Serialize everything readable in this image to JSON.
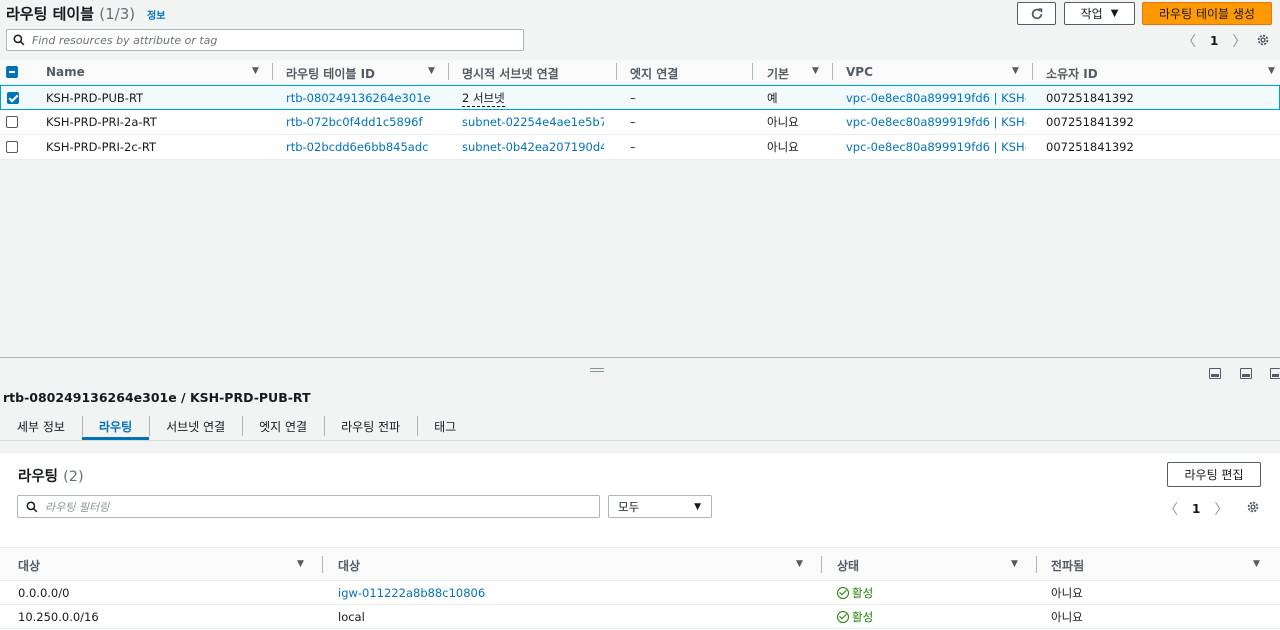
{
  "header": {
    "title": "라우팅 테이블",
    "count": "(1/3)",
    "info_link": "정보",
    "actions_label": "작업",
    "create_label": "라우팅 테이블 생성",
    "search_placeholder": "Find resources by attribute or tag",
    "page": "1"
  },
  "table": {
    "columns": [
      "Name",
      "라우팅 테이블 ID",
      "명시적 서브넷 연결",
      "엣지 연결",
      "기본",
      "VPC",
      "소유자 ID"
    ],
    "rows": [
      {
        "name": "KSH-PRD-PUB-RT",
        "id": "rtb-080249136264e301e",
        "subnet": "2 서브넷",
        "edge": "–",
        "main": "예",
        "vpc": "vpc-0e8ec80a899919fd6 | KSH-...",
        "owner": "007251841392",
        "selected": true
      },
      {
        "name": "KSH-PRD-PRI-2a-RT",
        "id": "rtb-072bc0f4dd1c5896f",
        "subnet": "subnet-02254e4ae1e5b7...",
        "edge": "–",
        "main": "아니요",
        "vpc": "vpc-0e8ec80a899919fd6 | KSH-...",
        "owner": "007251841392",
        "selected": false
      },
      {
        "name": "KSH-PRD-PRI-2c-RT",
        "id": "rtb-02bcdd6e6bb845adc",
        "subnet": "subnet-0b42ea207190d4...",
        "edge": "–",
        "main": "아니요",
        "vpc": "vpc-0e8ec80a899919fd6 | KSH-...",
        "owner": "007251841392",
        "selected": false
      }
    ]
  },
  "detail": {
    "title": "rtb-080249136264e301e / KSH-PRD-PUB-RT",
    "tabs": [
      "세부 정보",
      "라우팅",
      "서브넷 연결",
      "엣지 연결",
      "라우팅 전파",
      "태그"
    ],
    "active_tab": "라우팅",
    "routes_title": "라우팅",
    "routes_count": "(2)",
    "edit_label": "라우팅 편집",
    "filter_placeholder": "라우팅 필터링",
    "filter_select": "모두",
    "page": "1",
    "columns": [
      "대상",
      "대상",
      "상태",
      "전파됨"
    ],
    "routes": [
      {
        "destination": "0.0.0.0/0",
        "target": "igw-011222a8b88c10806",
        "status": "활성",
        "propagated": "아니요"
      },
      {
        "destination": "10.250.0.0/16",
        "target": "local",
        "status": "활성",
        "propagated": "아니요"
      }
    ]
  }
}
